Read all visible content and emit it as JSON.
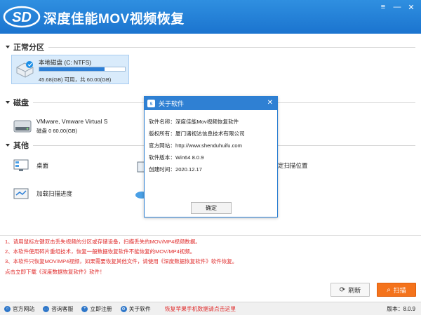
{
  "app": {
    "title": "深度佳能MOV视频恢复",
    "logo_text": "SD"
  },
  "sections": {
    "partitions": "正常分区",
    "disks": "磁盘",
    "others": "其他"
  },
  "partition": {
    "name": "本地磁盘 (C: NTFS)",
    "usage_fraction": 0.76,
    "size_text": "45.68(GB) 可用，共 60.00(GB)"
  },
  "hdd": {
    "name": "VMware, Vmware Virtual S",
    "size_text": "磁盘 0    60.00(GB)"
  },
  "others": [
    {
      "label": "桌面",
      "icon": "desktop-icon"
    },
    {
      "label": "加载扫描进度",
      "icon": "load-progress-icon"
    },
    {
      "label": "定扫描位置",
      "icon": "location-icon"
    }
  ],
  "dialog": {
    "title": "关于软件",
    "rows": [
      "软件名称：深度佳能Mov视频恢复软件",
      "版权所有：厦门诸视达信息技术有限公司",
      "官方网站：http://www.shenduhuifu.com",
      "软件版本：Win64 8.0.9",
      "创建时间：2020.12.17"
    ],
    "ok": "确定"
  },
  "notes": [
    "1、请用鼠标左键双击丢失视频的分区或存储设备，扫描丢失的MOV/MP4视频数据。",
    "2、本软件使用碎片重组技术，恢复一般数据恢复软件不能恢复的MOV/MP4视频。",
    "3、本软件只恢复MOV/MP4视频，如果需要恢复其他文件，请使用《深度数据恢复软件》软件恢复。",
    "   点击立即下载《深度数据恢复软件》软件！"
  ],
  "buttons": {
    "refresh": "刷新",
    "scan": "扫描"
  },
  "footer": {
    "items": [
      "官方网站",
      "咨询客服",
      "立即注册",
      "关于软件"
    ],
    "link": "恢复苹果手机数据请点击这里",
    "version": "版本：8.0.9"
  },
  "colors": {
    "title_bar": "#1b74cf",
    "accent": "#2f80d3",
    "scan": "#f4731c",
    "notes": "#e02b2b"
  }
}
